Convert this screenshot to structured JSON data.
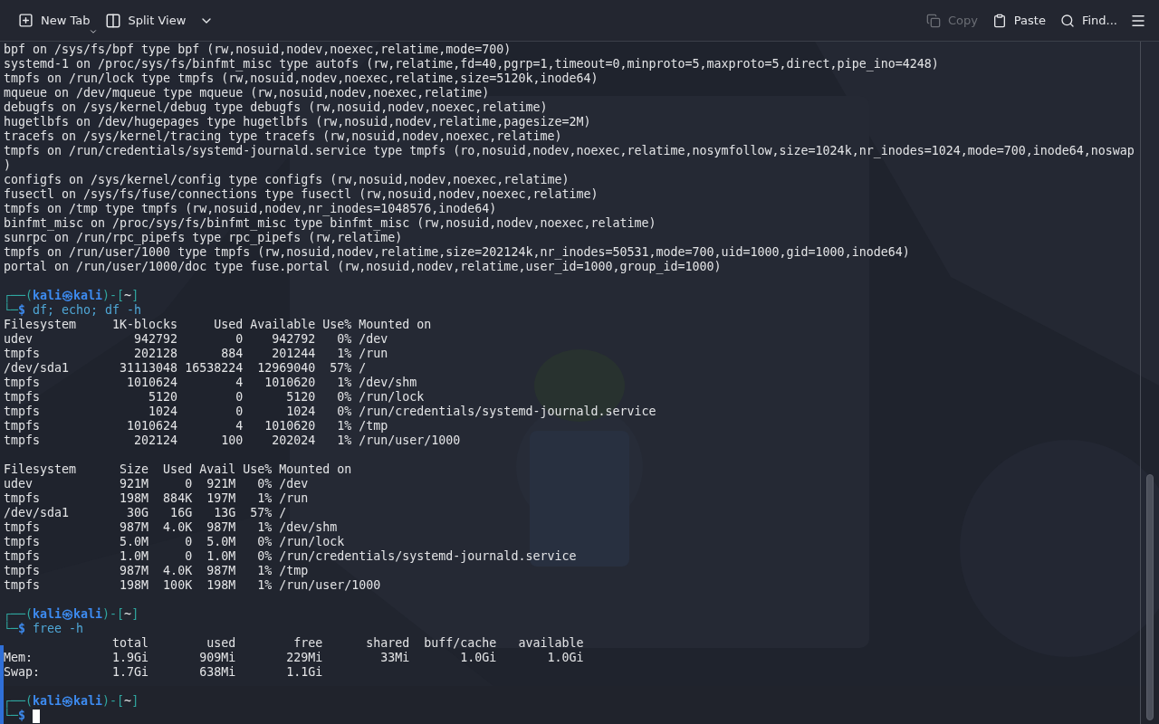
{
  "toolbar": {
    "left": [
      {
        "kind": "new_tab",
        "label": "New Tab",
        "disabled": false
      },
      {
        "kind": "split_view",
        "label": "Split View",
        "disabled": false
      }
    ],
    "right": [
      {
        "kind": "copy",
        "label": "Copy",
        "disabled": true
      },
      {
        "kind": "paste",
        "label": "Paste",
        "disabled": false
      },
      {
        "kind": "find",
        "label": "Find...",
        "disabled": false
      }
    ]
  },
  "terminal": {
    "lines": [
      {
        "kind": "output",
        "text": "bpf on /sys/fs/bpf type bpf (rw,nosuid,nodev,noexec,relatime,mode=700)"
      },
      {
        "kind": "output",
        "text": "systemd-1 on /proc/sys/fs/binfmt_misc type autofs (rw,relatime,fd=40,pgrp=1,timeout=0,minproto=5,maxproto=5,direct,pipe_ino=4248)"
      },
      {
        "kind": "output",
        "text": "tmpfs on /run/lock type tmpfs (rw,nosuid,nodev,noexec,relatime,size=5120k,inode64)"
      },
      {
        "kind": "output",
        "text": "mqueue on /dev/mqueue type mqueue (rw,nosuid,nodev,noexec,relatime)"
      },
      {
        "kind": "output",
        "text": "debugfs on /sys/kernel/debug type debugfs (rw,nosuid,nodev,noexec,relatime)"
      },
      {
        "kind": "output",
        "text": "hugetlbfs on /dev/hugepages type hugetlbfs (rw,nosuid,nodev,relatime,pagesize=2M)"
      },
      {
        "kind": "output",
        "text": "tracefs on /sys/kernel/tracing type tracefs (rw,nosuid,nodev,noexec,relatime)"
      },
      {
        "kind": "output",
        "text": "tmpfs on /run/credentials/systemd-journald.service type tmpfs (ro,nosuid,nodev,noexec,relatime,nosymfollow,size=1024k,nr_inodes=1024,mode=700,inode64,noswap"
      },
      {
        "kind": "output",
        "text": ")"
      },
      {
        "kind": "output",
        "text": "configfs on /sys/kernel/config type configfs (rw,nosuid,nodev,noexec,relatime)"
      },
      {
        "kind": "output",
        "text": "fusectl on /sys/fs/fuse/connections type fusectl (rw,nosuid,nodev,noexec,relatime)"
      },
      {
        "kind": "output",
        "text": "tmpfs on /tmp type tmpfs (rw,nosuid,nodev,nr_inodes=1048576,inode64)"
      },
      {
        "kind": "output",
        "text": "binfmt_misc on /proc/sys/fs/binfmt_misc type binfmt_misc (rw,nosuid,nodev,noexec,relatime)"
      },
      {
        "kind": "output",
        "text": "sunrpc on /run/rpc_pipefs type rpc_pipefs (rw,relatime)"
      },
      {
        "kind": "output",
        "text": "tmpfs on /run/user/1000 type tmpfs (rw,nosuid,nodev,relatime,size=202124k,nr_inodes=50531,mode=700,uid=1000,gid=1000,inode64)"
      },
      {
        "kind": "output",
        "text": "portal on /run/user/1000/doc type fuse.portal (rw,nosuid,nodev,relatime,user_id=1000,group_id=1000)"
      },
      {
        "kind": "blank"
      },
      {
        "kind": "prompt",
        "frame_open": "┌──(",
        "user": "kali㉿kali",
        "frame_mid": ")-[",
        "dir": "~",
        "frame_close": "]"
      },
      {
        "kind": "command",
        "frame": "└─",
        "sign": "$",
        "text": " df; echo; df -h",
        "cursor": false
      },
      {
        "kind": "output",
        "text": "Filesystem     1K-blocks     Used Available Use% Mounted on"
      },
      {
        "kind": "output",
        "text": "udev              942792        0    942792   0% /dev"
      },
      {
        "kind": "output",
        "text": "tmpfs             202128      884    201244   1% /run"
      },
      {
        "kind": "output",
        "text": "/dev/sda1       31113048 16538224  12969040  57% /"
      },
      {
        "kind": "output",
        "text": "tmpfs            1010624        4   1010620   1% /dev/shm"
      },
      {
        "kind": "output",
        "text": "tmpfs               5120        0      5120   0% /run/lock"
      },
      {
        "kind": "output",
        "text": "tmpfs               1024        0      1024   0% /run/credentials/systemd-journald.service"
      },
      {
        "kind": "output",
        "text": "tmpfs            1010624        4   1010620   1% /tmp"
      },
      {
        "kind": "output",
        "text": "tmpfs             202124      100    202024   1% /run/user/1000"
      },
      {
        "kind": "blank"
      },
      {
        "kind": "output",
        "text": "Filesystem      Size  Used Avail Use% Mounted on"
      },
      {
        "kind": "output",
        "text": "udev            921M     0  921M   0% /dev"
      },
      {
        "kind": "output",
        "text": "tmpfs           198M  884K  197M   1% /run"
      },
      {
        "kind": "output",
        "text": "/dev/sda1        30G   16G   13G  57% /"
      },
      {
        "kind": "output",
        "text": "tmpfs           987M  4.0K  987M   1% /dev/shm"
      },
      {
        "kind": "output",
        "text": "tmpfs           5.0M     0  5.0M   0% /run/lock"
      },
      {
        "kind": "output",
        "text": "tmpfs           1.0M     0  1.0M   0% /run/credentials/systemd-journald.service"
      },
      {
        "kind": "output",
        "text": "tmpfs           987M  4.0K  987M   1% /tmp"
      },
      {
        "kind": "output",
        "text": "tmpfs           198M  100K  198M   1% /run/user/1000"
      },
      {
        "kind": "blank"
      },
      {
        "kind": "prompt",
        "frame_open": "┌──(",
        "user": "kali㉿kali",
        "frame_mid": ")-[",
        "dir": "~",
        "frame_close": "]"
      },
      {
        "kind": "command",
        "frame": "└─",
        "sign": "$",
        "text": " free -h",
        "cursor": false
      },
      {
        "kind": "output",
        "text": "               total        used        free      shared  buff/cache   available"
      },
      {
        "kind": "output",
        "text": "Mem:           1.9Gi       909Mi       229Mi        33Mi       1.0Gi       1.0Gi"
      },
      {
        "kind": "output",
        "text": "Swap:          1.7Gi       638Mi       1.1Gi"
      },
      {
        "kind": "blank"
      },
      {
        "kind": "prompt",
        "frame_open": "┌──(",
        "user": "kali㉿kali",
        "frame_mid": ")-[",
        "dir": "~",
        "frame_close": "]"
      },
      {
        "kind": "command",
        "frame": "└─",
        "sign": "$",
        "cursor": true
      }
    ]
  }
}
